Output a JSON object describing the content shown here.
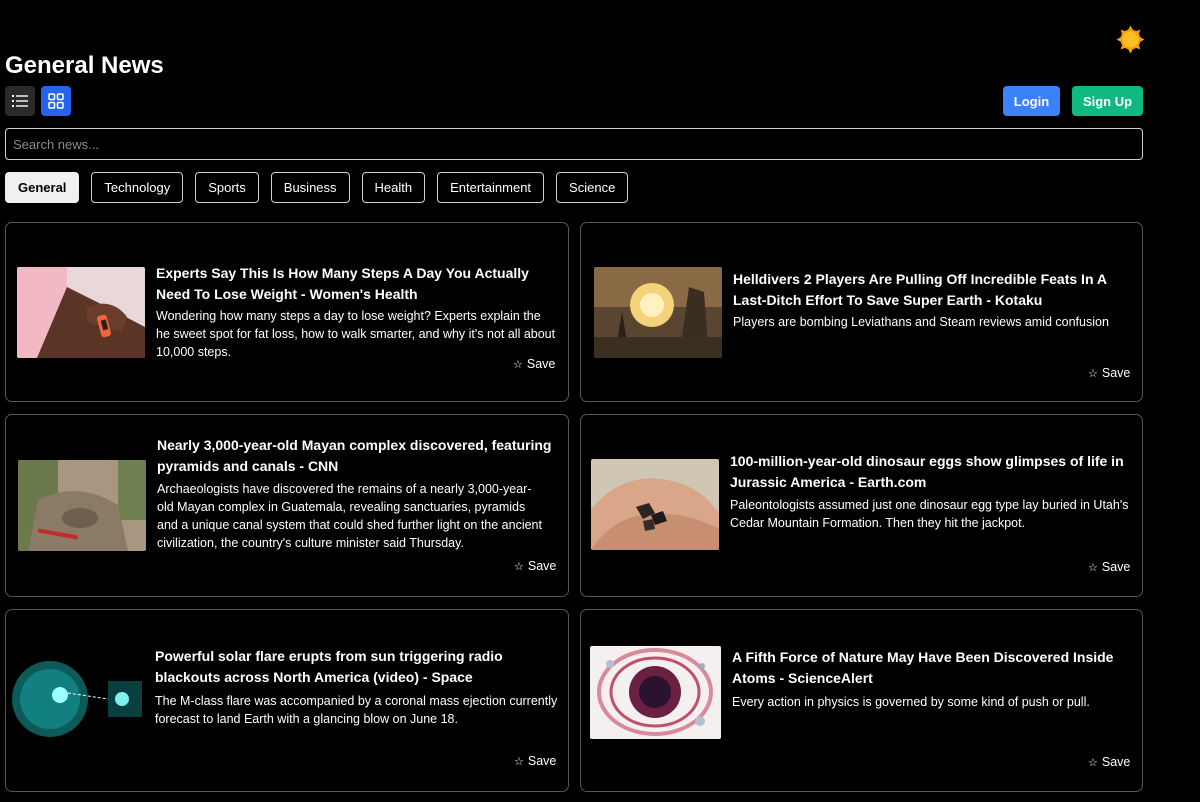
{
  "page": {
    "title": "General News"
  },
  "auth": {
    "login_label": "Login",
    "signup_label": "Sign Up"
  },
  "search": {
    "placeholder": "Search news..."
  },
  "categories": [
    "General",
    "Technology",
    "Sports",
    "Business",
    "Health",
    "Entertainment",
    "Science"
  ],
  "active_category": "General",
  "colors": {
    "accent_blue": "#3b82f6",
    "accent_green": "#10b981",
    "grid_active": "#2563eb",
    "sun": "#f59e0b"
  },
  "icons": {
    "theme": "sun-icon",
    "list_view": "list-icon",
    "grid_view": "grid-icon",
    "save": "star-icon"
  },
  "articles": [
    {
      "title": "Experts Say This Is How Many Steps A Day You Actually Need To Lose Weight - Women's Health",
      "description": "Wondering how many steps a day to lose weight? Experts explain the  he sweet spot for fat loss, how to walk smarter, and why it's not all about 10,000 steps.",
      "save_label": "Save"
    },
    {
      "title": "Helldivers 2 Players Are Pulling Off Incredible Feats In A Last-Ditch Effort To Save Super Earth - Kotaku",
      "description": "Players are bombing Leviathans and Steam reviews amid confusion",
      "save_label": "Save"
    },
    {
      "title": "Nearly 3,000-year-old Mayan complex discovered, featuring pyramids and canals - CNN",
      "description": "Archaeologists have discovered the remains of a nearly 3,000-year-old Mayan complex in Guatemala, revealing sanctuaries, pyramids and a unique canal system that could shed further light on the ancient civilization, the country's culture minister said Thursday.",
      "save_label": "Save"
    },
    {
      "title": "100-million-year-old dinosaur eggs show glimpses of life in Jurassic America - Earth.com",
      "description": "Paleontologists assumed just one dinosaur egg type lay buried in Utah's Cedar Mountain Formation. Then they hit the jackpot.",
      "save_label": "Save"
    },
    {
      "title": "Powerful solar flare erupts from sun triggering radio blackouts across North America (video) - Space",
      "description": "The M-class flare was accompanied by a coronal mass ejection currently forecast to land Earth with a glancing blow on June 18.",
      "save_label": "Save"
    },
    {
      "title": "A Fifth Force of Nature May Have Been Discovered Inside Atoms - ScienceAlert",
      "description": "Every action in physics is governed by some kind of push or pull.",
      "save_label": "Save"
    }
  ]
}
